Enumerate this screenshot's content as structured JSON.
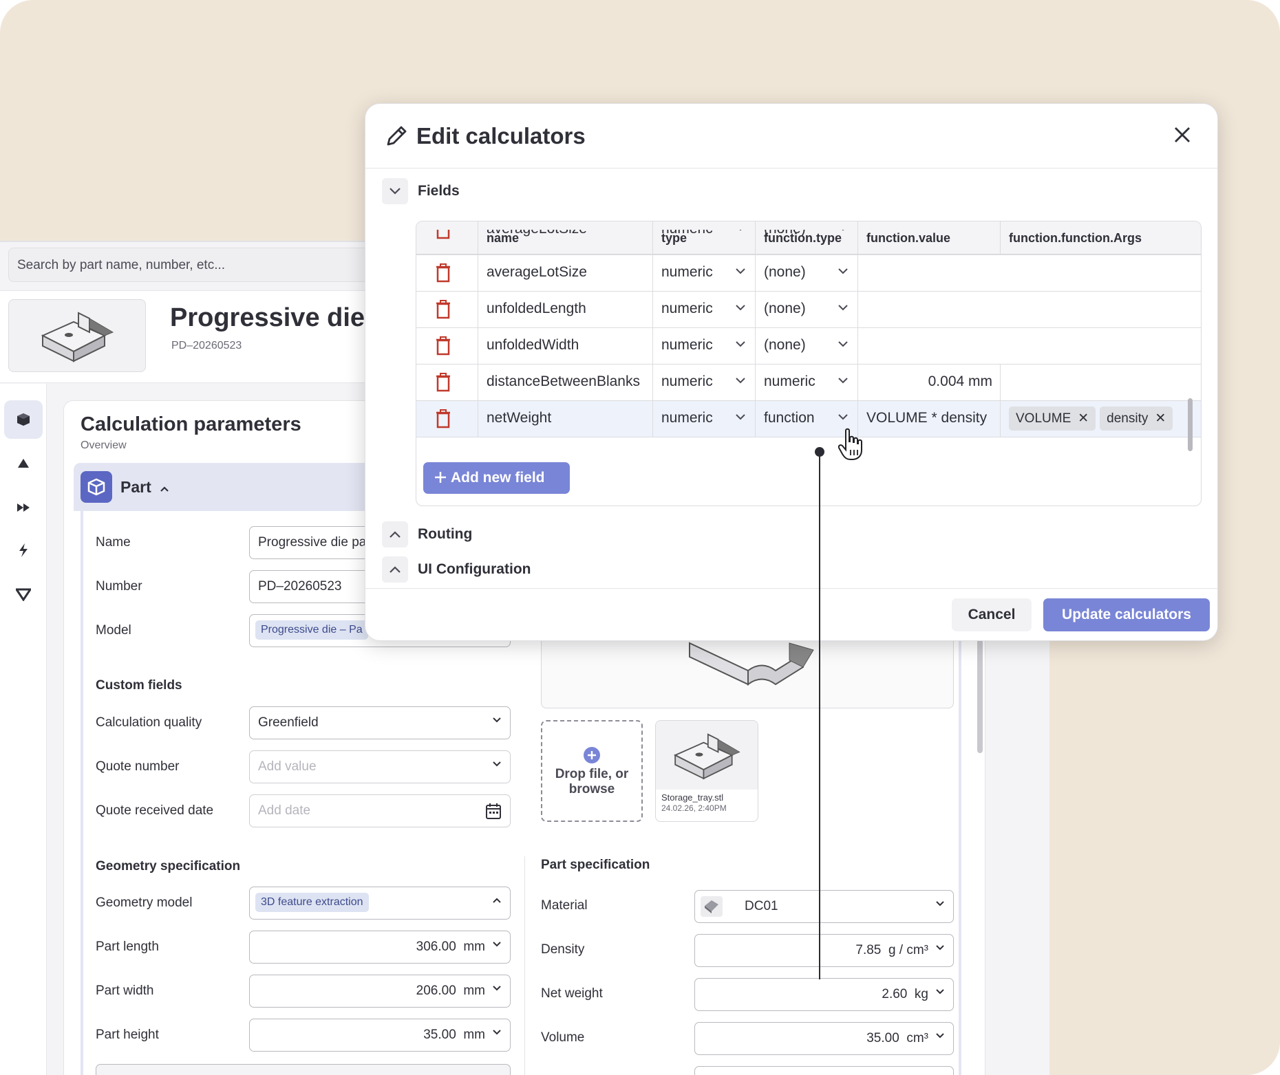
{
  "app": {
    "search_placeholder": "Search by part name, number, etc...",
    "title": "Progressive die",
    "subtitle": "PD–20260523",
    "panel_title": "Calculation parameters",
    "panel_subtitle": "Overview",
    "part_section": "Part"
  },
  "part_fields": {
    "name_label": "Name",
    "name_value": "Progressive die pa",
    "number_label": "Number",
    "number_value": "PD–20260523",
    "model_label": "Model",
    "model_chip": "Progressive die – Pa"
  },
  "custom_fields": {
    "heading": "Custom fields",
    "calc_quality_label": "Calculation quality",
    "calc_quality_value": "Greenfield",
    "quote_number_label": "Quote number",
    "quote_number_placeholder": "Add value",
    "quote_date_label": "Quote received date",
    "quote_date_placeholder": "Add date"
  },
  "geometry": {
    "heading": "Geometry specification",
    "model_label": "Geometry model",
    "model_chip": "3D feature extraction",
    "length_label": "Part length",
    "length_value": "306.00",
    "length_unit": "mm",
    "width_label": "Part width",
    "width_value": "206.00",
    "width_unit": "mm",
    "height_label": "Part height",
    "height_value": "35.00",
    "height_unit": "mm"
  },
  "files": {
    "drop_line1": "Drop file, or",
    "drop_line2": "browse",
    "file_name": "Storage_tray.stl",
    "file_date": "24.02.26, 2:40PM"
  },
  "part_spec": {
    "heading": "Part specification",
    "material_label": "Material",
    "material_value": "DC01",
    "density_label": "Density",
    "density_value": "7.85",
    "density_unit": "g / cm³",
    "net_weight_label": "Net weight",
    "net_weight_value": "2.60",
    "net_weight_unit": "kg",
    "volume_label": "Volume",
    "volume_value": "35.00",
    "volume_unit": "cm³"
  },
  "modal": {
    "title": "Edit calculators",
    "sections": {
      "fields": "Fields",
      "routing": "Routing",
      "ui_config": "UI Configuration"
    },
    "columns": [
      "name",
      "type",
      "function.type",
      "function.value",
      "function.function.Args"
    ],
    "rows": [
      {
        "name": "averageLotSize",
        "type": "numeric",
        "ftype": "(none)",
        "fvalue": "",
        "args": []
      },
      {
        "name": "averageLotSize",
        "type": "numeric",
        "ftype": "(none)",
        "fvalue": "",
        "args": []
      },
      {
        "name": "unfoldedLength",
        "type": "numeric",
        "ftype": "(none)",
        "fvalue": "",
        "args": []
      },
      {
        "name": "unfoldedWidth",
        "type": "numeric",
        "ftype": "(none)",
        "fvalue": "",
        "args": []
      },
      {
        "name": "distanceBetweenBlanks",
        "type": "numeric",
        "ftype": "numeric",
        "fvalue": "0.004 mm",
        "args": []
      },
      {
        "name": "netWeight",
        "type": "numeric",
        "ftype": "function",
        "fvalue": "VOLUME * density",
        "args": [
          "VOLUME",
          "density"
        ]
      }
    ],
    "add_button": "Add new field",
    "cancel": "Cancel",
    "update": "Update calculators"
  },
  "colors": {
    "accent": "#7985d6",
    "accent_dark": "#5b67c2",
    "delete": "#c0392b",
    "background": "#f0e6d8"
  }
}
